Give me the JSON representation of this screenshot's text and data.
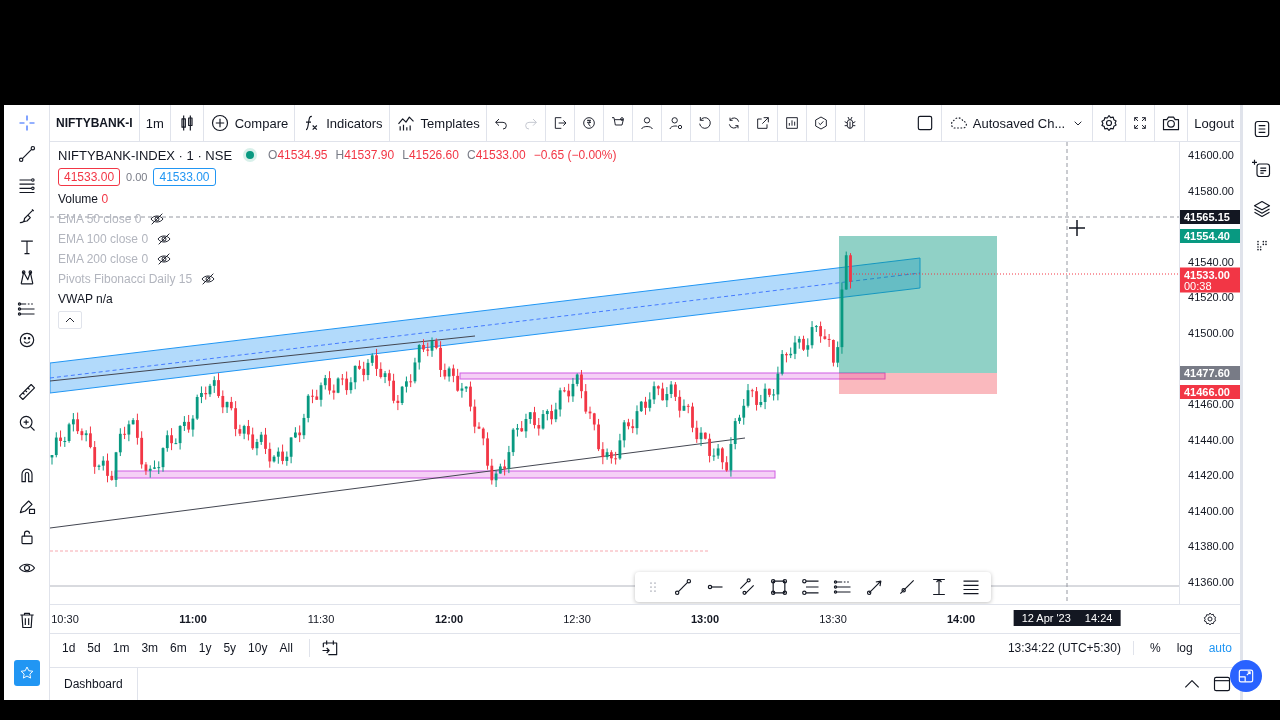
{
  "toolbar": {
    "symbol": "NIFTYBANK-I",
    "interval": "1m",
    "buttons": [
      {
        "label": "Compare"
      },
      {
        "label": "Indicators"
      },
      {
        "label": "Templates"
      }
    ],
    "layout_name": "Autosaved Ch...",
    "logout": "Logout"
  },
  "legend": {
    "title": "NIFTYBANK-INDEX · 1 · NSE",
    "status": {
      "color": "#089981"
    },
    "ohlc": [
      {
        "label": "O",
        "value": "41534.95"
      },
      {
        "label": "H",
        "value": "41537.90"
      },
      {
        "label": "L",
        "value": "41526.60"
      },
      {
        "label": "C",
        "value": "41533.00"
      }
    ],
    "change": "−0.65 (−0.00%)",
    "sell": "41533.00",
    "spread": "0.00",
    "buy": "41533.00",
    "indicators": [
      {
        "name": "Volume",
        "value": "0",
        "hidden": false,
        "color": "#f23645"
      },
      {
        "name": "EMA 50 close",
        "value": "0",
        "hidden": true,
        "color": "#b2b5be"
      },
      {
        "name": "EMA 100 close",
        "value": "0",
        "hidden": true,
        "color": "#b2b5be"
      },
      {
        "name": "EMA 200 close",
        "value": "0",
        "hidden": true,
        "color": "#b2b5be"
      },
      {
        "name": "Pivots Fibonacci Daily",
        "value": "15",
        "hidden": true,
        "color": "#b2b5be"
      },
      {
        "name": "VWAP",
        "value": "n/a",
        "hidden": false,
        "color": "#131722"
      }
    ]
  },
  "price_axis": {
    "ticks": [
      "41600.00",
      "41580.00",
      "41540.00",
      "41520.00",
      "41500.00",
      "41460.00",
      "41440.00",
      "41420.00",
      "41400.00",
      "41380.00",
      "41360.00"
    ],
    "badges": [
      {
        "text": "41565.15",
        "color": "#131722"
      },
      {
        "text": "41554.40",
        "color": "#089981"
      },
      {
        "text": "41533.00",
        "sub": "00:38",
        "color": "#f23645"
      },
      {
        "text": "41477.60",
        "color": "#787b86"
      },
      {
        "text": "41466.00",
        "color": "#f23645"
      }
    ]
  },
  "time_axis": {
    "labels": [
      {
        "text": "10:30",
        "bold": false
      },
      {
        "text": "11:00",
        "bold": true
      },
      {
        "text": "11:30",
        "bold": false
      },
      {
        "text": "12:00",
        "bold": true
      },
      {
        "text": "12:30",
        "bold": false
      },
      {
        "text": "13:00",
        "bold": true
      },
      {
        "text": "13:30",
        "bold": false
      },
      {
        "text": "14:00",
        "bold": true
      }
    ],
    "crosshair_date": "12 Apr '23",
    "crosshair_time": "14:24"
  },
  "ranges": [
    {
      "label": "1d"
    },
    {
      "label": "5d"
    },
    {
      "label": "1m"
    },
    {
      "label": "3m"
    },
    {
      "label": "6m"
    },
    {
      "label": "1y"
    },
    {
      "label": "5y"
    },
    {
      "label": "10y"
    },
    {
      "label": "All"
    }
  ],
  "clock": "13:34:22 (UTC+5:30)",
  "scale_modes": [
    {
      "label": "%",
      "selected": false
    },
    {
      "label": "log",
      "selected": false
    },
    {
      "label": "auto",
      "selected": true
    }
  ],
  "bottom_panel": {
    "tab": "Dashboard"
  }
}
